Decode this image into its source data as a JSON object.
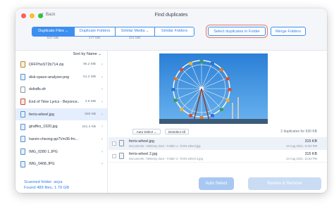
{
  "window": {
    "title": "Find duplicates",
    "back_label": "Back"
  },
  "tabs": [
    {
      "label": "Duplicate Files",
      "chevron": "⌄",
      "size": "537 MB",
      "active": true
    },
    {
      "label": "Duplicate Folders",
      "size": "177 MB",
      "active": false
    },
    {
      "label": "Similar Media",
      "chevron": "⌄",
      "size": "101 MB",
      "active": false
    },
    {
      "label": "Similar Folders",
      "size": "",
      "active": false
    }
  ],
  "actions": {
    "select_in_folder": "Select duplicates in Folder",
    "merge_folders": "Merge Folders"
  },
  "sort": {
    "label": "Sort by Name",
    "chevron": "⌄"
  },
  "files": [
    {
      "name": "DFFPhoST2b714.zip",
      "size": "96.2 MB",
      "icon": "archive"
    },
    {
      "name": "disk-space-analyzer.png",
      "size": "51.2 MB",
      "icon": "image"
    },
    {
      "name": "dsfsdfs.sfr",
      "size": "",
      "icon": "doc"
    },
    {
      "name": "End of Time Lyrics - Beyonce...",
      "size": "4.9 MB",
      "icon": "audio"
    },
    {
      "name": "ferris-wheel.jpg",
      "size": "630 KB",
      "icon": "image"
    },
    {
      "name": "giraffes_1920.jpg",
      "size": "441.4 KB",
      "icon": "image"
    },
    {
      "name": "harvin-cheong-pp7Vm36-fm...",
      "size": "",
      "icon": "image"
    },
    {
      "name": "IMG_0280 1.JPG",
      "size": "",
      "icon": "image"
    },
    {
      "name": "IMG_0468.JPG",
      "size": "",
      "icon": "image"
    }
  ],
  "selected_file_index": 4,
  "scan": {
    "folder_line": "Scanned folder: asya",
    "found_line": "Found 489 files, 1.79 GB"
  },
  "preview": {
    "caption": "ferris-wheel.jpg"
  },
  "list_controls": {
    "auto_select": "Auto Select",
    "auto_select_chevron": "⌄",
    "deselect_all": "Deselect All",
    "count": "2 duplicates for 630 KB"
  },
  "duplicates": [
    {
      "name": "ferris-wheel.jpg",
      "path": "Documents  ›  Nektony docs  ›  Folder 1  ›  ferris-wheel.jpg",
      "size": "315 KB",
      "date": "24 Aug 2022, 12:53 PM"
    },
    {
      "name": "ferris-wheel 2.jpg",
      "path": "Documents  ›  Nektony docs  ›  Folder 2  ›  ferris-wheel 2.jpg",
      "size": "315 KB",
      "date": "24 Aug 2022, 12:53 PM"
    }
  ],
  "bottom": {
    "auto_select": "Auto Select",
    "review_remove": "Review & Remove"
  },
  "colors": {
    "accent": "#3d8ff0",
    "selected_row": "#e4eefc",
    "highlight_outline": "#e87a72"
  }
}
